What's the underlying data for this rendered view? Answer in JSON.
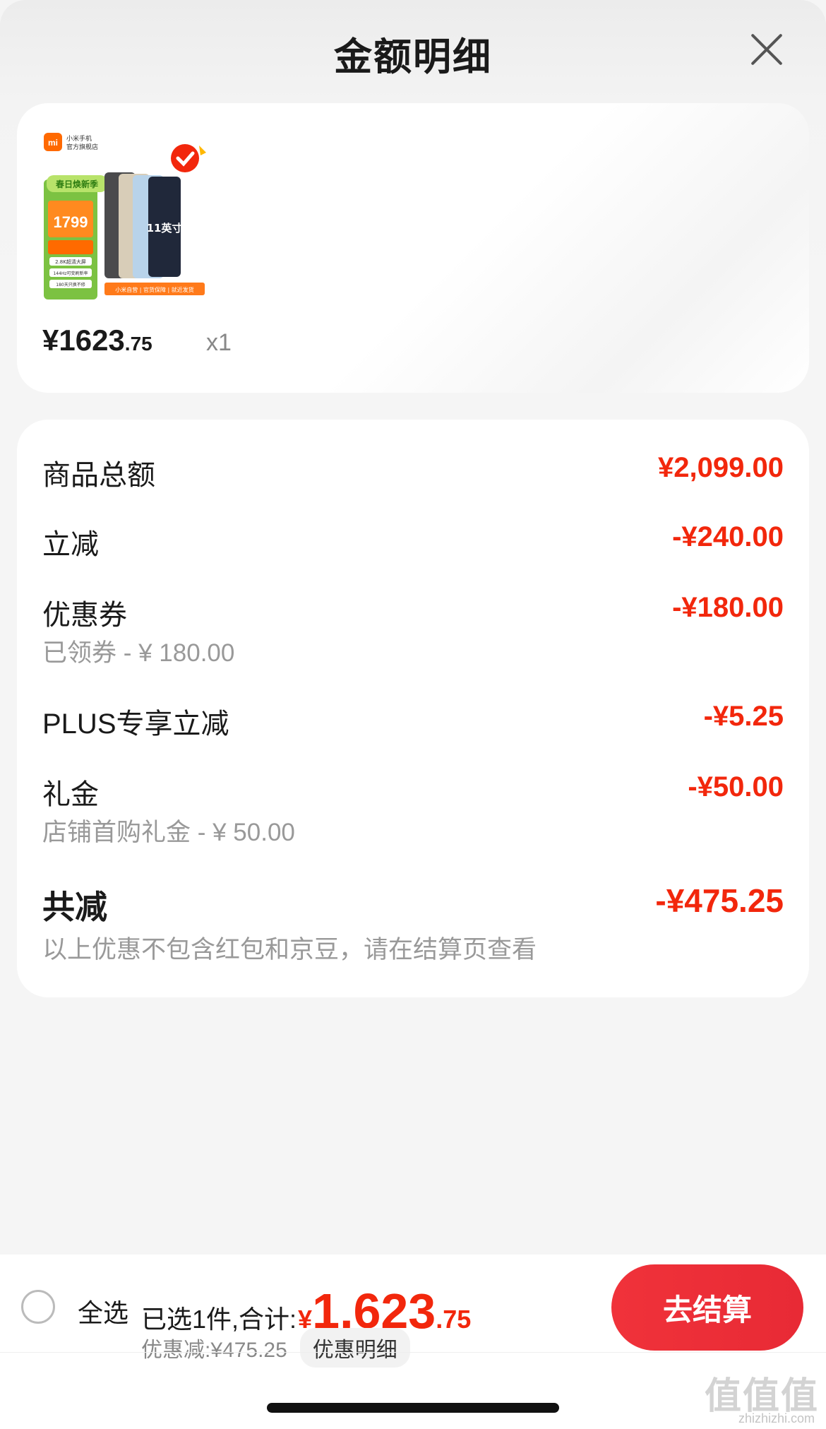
{
  "header": {
    "title": "金额明细"
  },
  "product": {
    "image_text": {
      "brand": "小米手机",
      "store": "官方旗舰店",
      "promo_label": "春日焕新季",
      "price": "1799",
      "size_label": "11英寸",
      "features": [
        "2.8K超清大屏",
        "144Hz可变刷新率",
        "180天只换不修"
      ],
      "footer": "小米自营 | 官货保障 | 就近发货"
    },
    "price_yen": "¥",
    "price_int": "1623",
    "price_dec": ".75",
    "quantity": "x1"
  },
  "details": {
    "rows": [
      {
        "label": "商品总额",
        "amount": "¥2,099.00",
        "sub": ""
      },
      {
        "label": "立减",
        "amount": "-¥240.00",
        "sub": ""
      },
      {
        "label": "优惠券",
        "amount": "-¥180.00",
        "sub": "已领券 - ¥ 180.00"
      },
      {
        "label": "PLUS专享立减",
        "amount": "-¥5.25",
        "sub": ""
      },
      {
        "label": "礼金",
        "amount": "-¥50.00",
        "sub": "店铺首购礼金 - ¥ 50.00"
      }
    ],
    "total": {
      "label": "共减",
      "amount": "-¥475.25",
      "note": "以上优惠不包含红包和京豆，请在结算页查看"
    }
  },
  "bottom_bar": {
    "select_all_label": "全选",
    "selected_text": "已选1件,合计:",
    "total_yen": "¥",
    "total_int": "1,623",
    "total_dec": ".75",
    "discount_text": "优惠减:¥475.25",
    "promo_detail_label": "优惠明细",
    "checkout_label": "去结算"
  },
  "watermark": {
    "mark": "值值值",
    "site": "zhizhizhi.com"
  },
  "colors": {
    "accent_red": "#f2270c",
    "checkout_button": "#e82a35"
  }
}
